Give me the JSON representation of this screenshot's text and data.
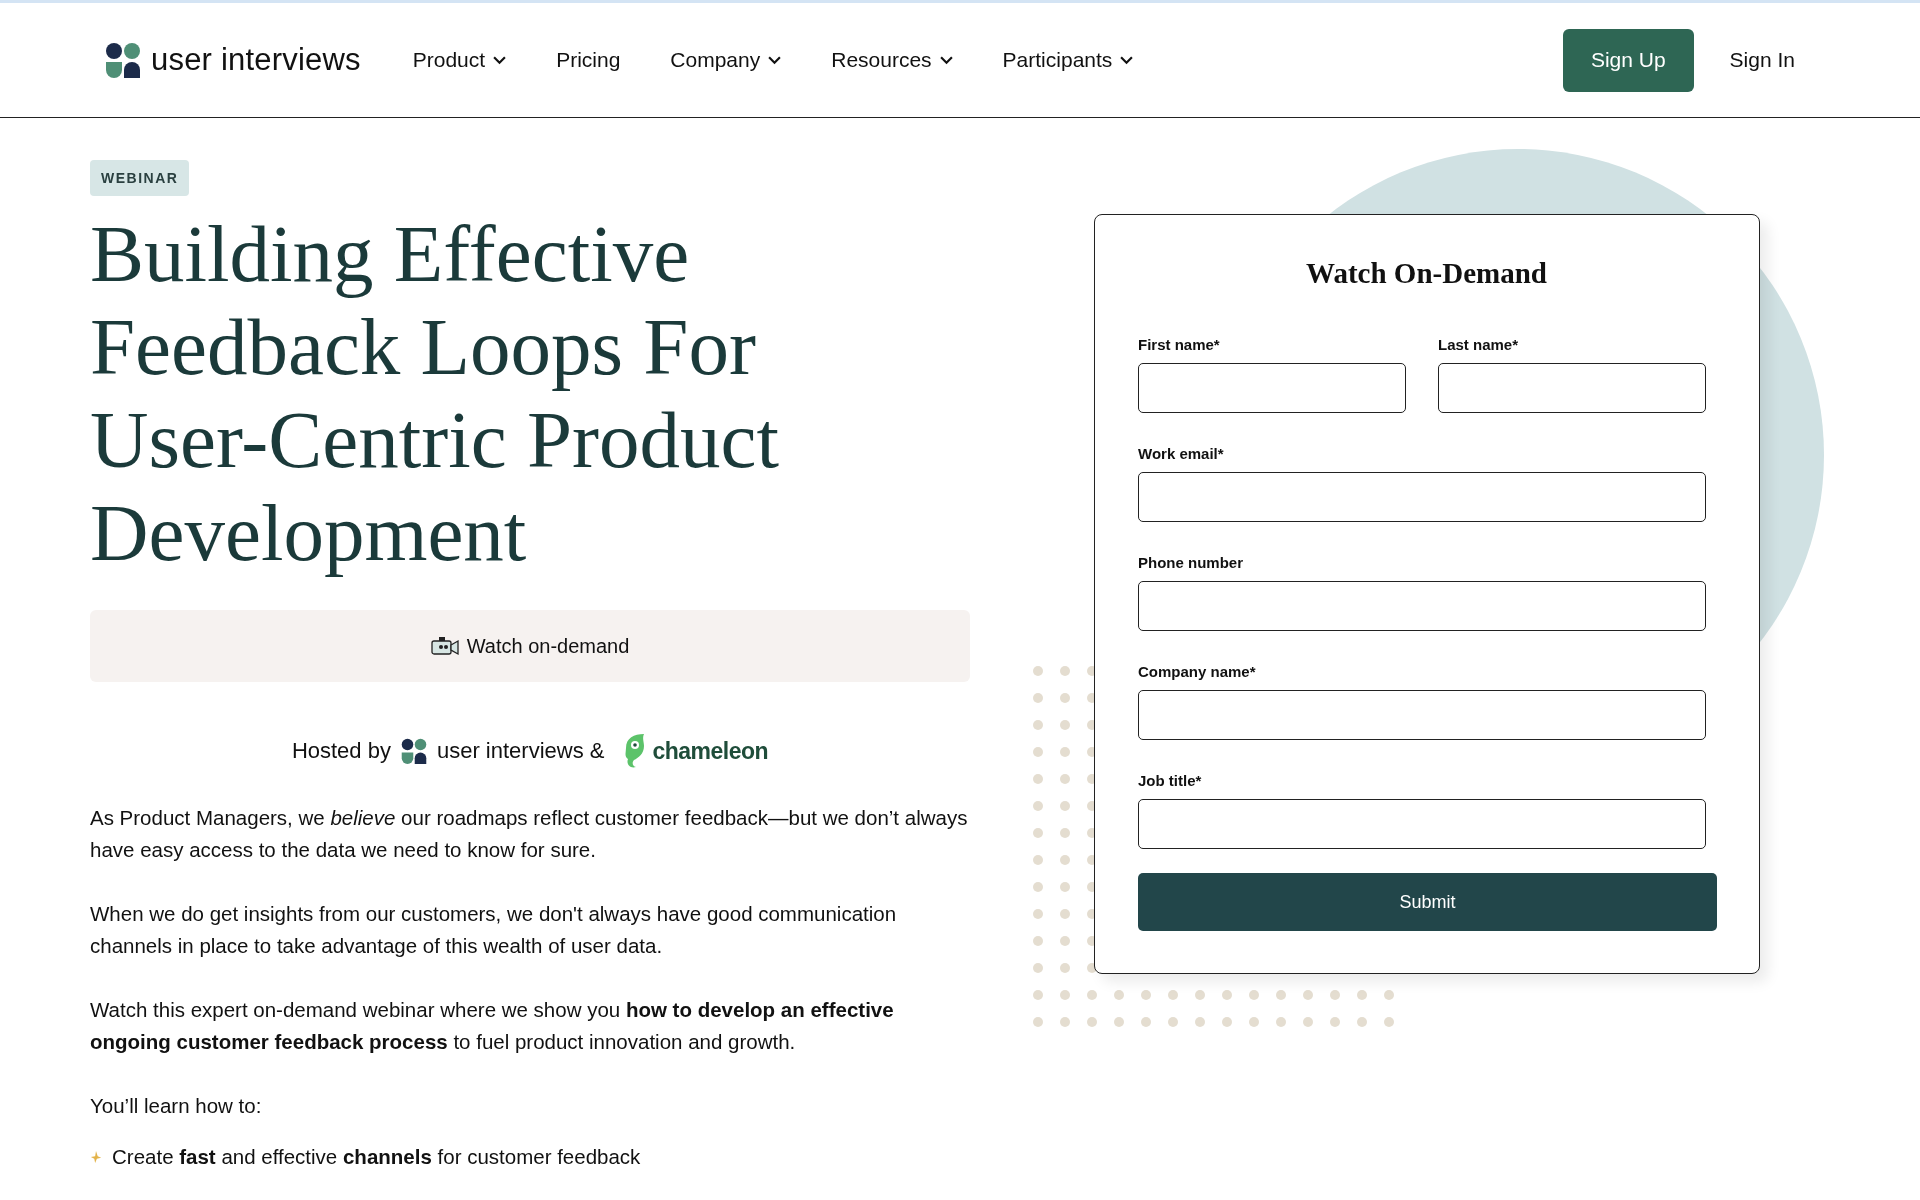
{
  "header": {
    "brand": "user interviews",
    "nav": [
      {
        "label": "Product",
        "has_menu": true
      },
      {
        "label": "Pricing",
        "has_menu": false
      },
      {
        "label": "Company",
        "has_menu": true
      },
      {
        "label": "Resources",
        "has_menu": true
      },
      {
        "label": "Participants",
        "has_menu": true
      }
    ],
    "actions": [
      {
        "label": "Sign Up",
        "kind": "primary"
      },
      {
        "label": "Sign In",
        "kind": "plain"
      }
    ]
  },
  "badge": "WEBINAR",
  "title": "Building Effective Feedback Loops For User-Centric Product Development",
  "watch_button": "Watch on-demand",
  "hosted": {
    "prefix": "Hosted by",
    "brand": "user interviews &",
    "partner": "chameleon"
  },
  "paragraphs": [
    "As Product Managers, we *believe* our roadmaps reflect customer feedback—but we don’t always have easy access to the data we need to know for sure.",
    "When we do get insights from our customers, we don't always have good communication channels in place to take advantage of this wealth of user data.",
    "Watch this expert on-demand webinar where we show you **how to develop an effective ongoing customer feedback process** to fuel product innovation and growth."
  ],
  "learn_heading": "You’ll learn how to:",
  "learn_items": [
    "Create **fast** and effective **channels** for customer feedback"
  ],
  "form": {
    "title": "Watch On-Demand",
    "fields": [
      {
        "label": "First name*",
        "kind": "half"
      },
      {
        "label": "Last name*",
        "kind": "half"
      },
      {
        "label": "Work email*",
        "kind": "full"
      },
      {
        "label": "Phone number",
        "kind": "full"
      },
      {
        "label": "Company name*",
        "kind": "full"
      },
      {
        "label": "Job title*",
        "kind": "full"
      }
    ],
    "submit": "Submit"
  }
}
